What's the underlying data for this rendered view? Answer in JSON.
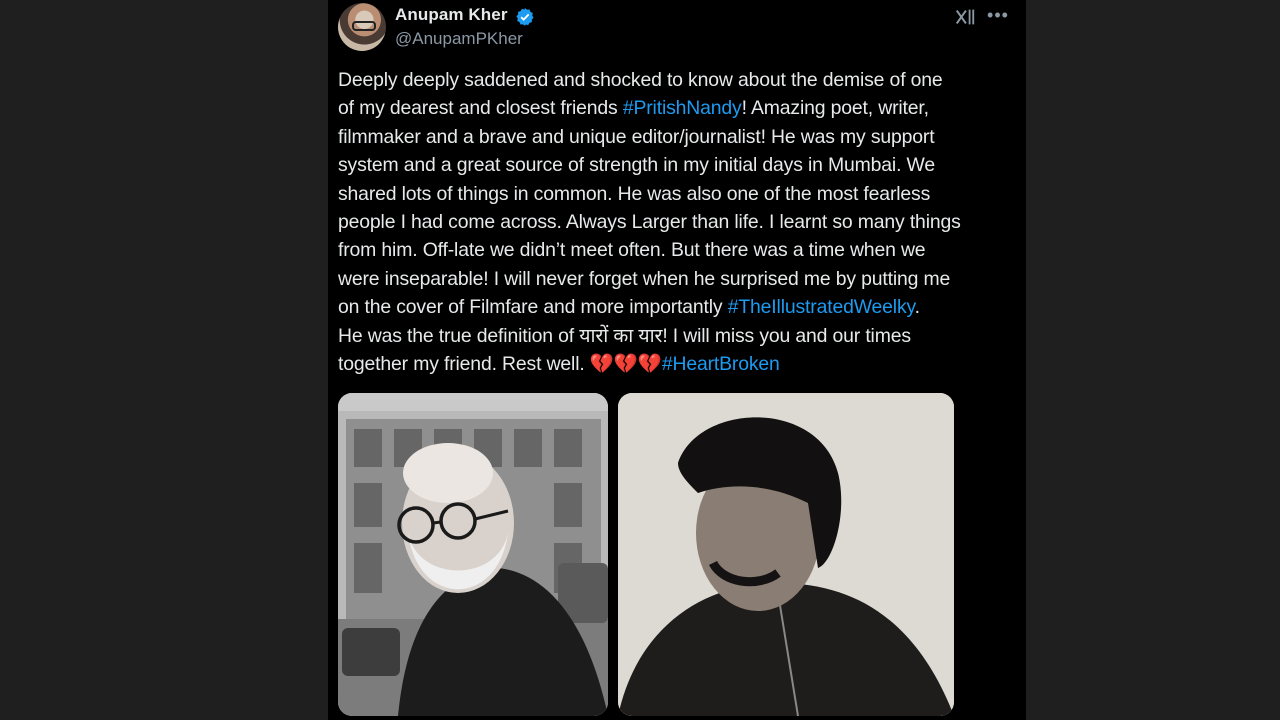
{
  "tweet": {
    "author": {
      "display_name": "Anupam Kher",
      "handle": "@AnupamPKher",
      "verified": true
    },
    "icons": {
      "grok": "grok-icon",
      "more": "more-icon"
    },
    "text_lines": [
      [
        {
          "t": "Deeply deeply saddened and shocked to know about the demise of one"
        }
      ],
      [
        {
          "t": "of my dearest and closest friends "
        },
        {
          "t": "#PritishNandy",
          "tag": true
        },
        {
          "t": "! Amazing poet, writer,"
        }
      ],
      [
        {
          "t": "filmmaker and a brave and unique editor/journalist! He was my support"
        }
      ],
      [
        {
          "t": "system and a great source of strength in my initial days in Mumbai. We"
        }
      ],
      [
        {
          "t": "shared lots of things in common. He was also one of the most fearless"
        }
      ],
      [
        {
          "t": "people I had come across. Always Larger than life. I learnt so many things"
        }
      ],
      [
        {
          "t": "from him. Off-late we didn’t meet often. But there was a time when we"
        }
      ],
      [
        {
          "t": "were inseparable! I will never forget when he surprised me by putting me"
        }
      ],
      [
        {
          "t": "on the cover of Filmfare and more importantly "
        },
        {
          "t": "#TheIllustratedWeelky",
          "tag": true
        },
        {
          "t": "."
        }
      ],
      [
        {
          "t": "He was the true definition of यारों का यार! I will miss you and our times"
        }
      ],
      [
        {
          "t": "together my friend. Rest well. "
        },
        {
          "t": "💔💔💔",
          "heart": true
        },
        {
          "t": "#HeartBroken",
          "tag": true
        }
      ]
    ],
    "colors": {
      "background": "#000000",
      "text": "#e7e9ea",
      "secondary": "#8b98a5",
      "hashtag": "#1d9bf0",
      "verified": "#1d9bf0"
    },
    "media": [
      {
        "name": "photo-older-man-glasses-street",
        "style": "black-and-white"
      },
      {
        "name": "photo-young-man-profile",
        "style": "sepia-black-and-white"
      }
    ]
  }
}
